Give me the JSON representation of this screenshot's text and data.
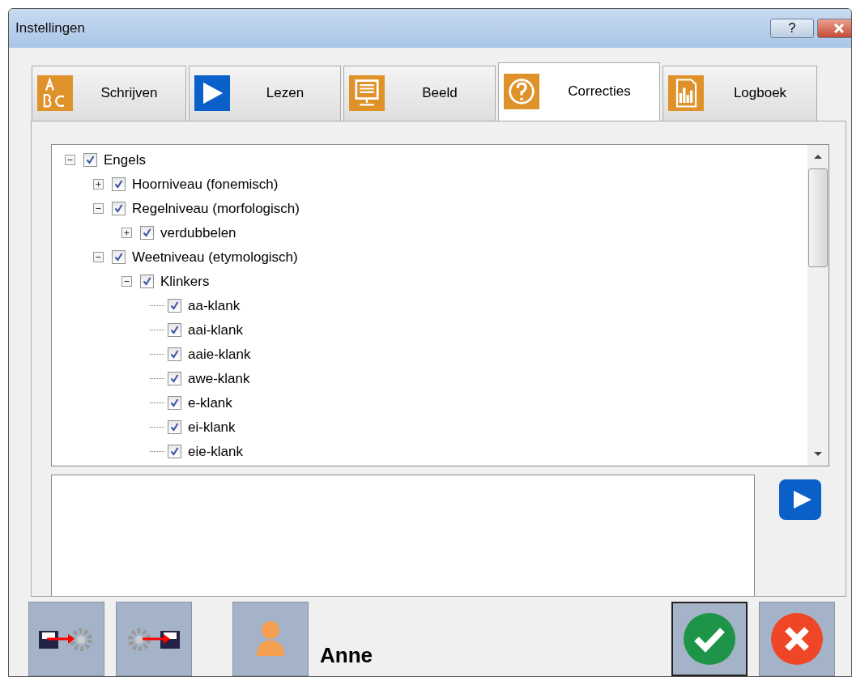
{
  "window": {
    "title": "Instellingen",
    "buttons": [
      "?"
    ]
  },
  "tabs": [
    {
      "label": "Schrijven",
      "selected": false
    },
    {
      "label": "Lezen",
      "selected": false
    },
    {
      "label": "Beeld",
      "selected": false
    },
    {
      "label": "Correcties",
      "selected": true
    },
    {
      "label": "Logboek",
      "selected": false
    }
  ],
  "tree": [
    {
      "label": "Engels",
      "checked": true,
      "expanded": true,
      "children": [
        {
          "label": "Hoorniveau (fonemisch)",
          "checked": true,
          "expanded": false
        },
        {
          "label": "Regelniveau (morfologisch)",
          "checked": true,
          "expanded": true,
          "children": [
            {
              "label": "verdubbelen",
              "checked": true,
              "expanded": false
            }
          ]
        },
        {
          "label": "Weetniveau (etymologisch)",
          "checked": true,
          "expanded": true,
          "children": [
            {
              "label": "Klinkers",
              "checked": true,
              "expanded": true,
              "children": [
                {
                  "label": "aa-klank",
                  "checked": true
                },
                {
                  "label": "aai-klank",
                  "checked": true
                },
                {
                  "label": "aaie-klank",
                  "checked": true
                },
                {
                  "label": "awe-klank",
                  "checked": true
                },
                {
                  "label": "e-klank",
                  "checked": true
                },
                {
                  "label": "ei-klank",
                  "checked": true
                },
                {
                  "label": "eie-klank",
                  "checked": true
                }
              ]
            }
          ]
        }
      ]
    }
  ],
  "user": {
    "name": "Anne"
  }
}
